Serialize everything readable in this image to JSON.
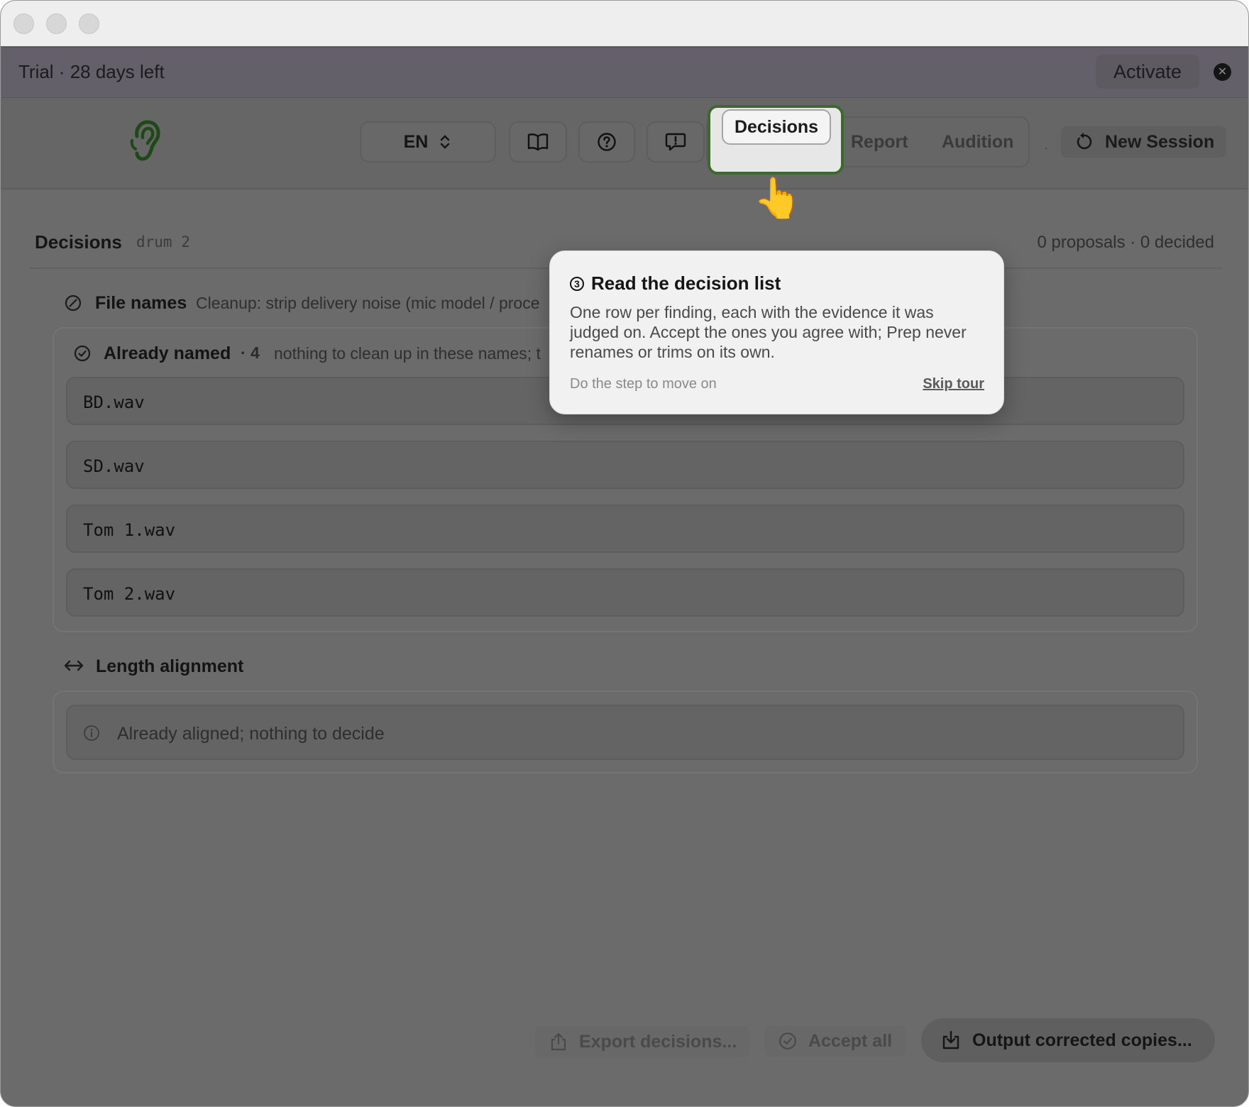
{
  "window": {
    "traffic_lights": [
      "close",
      "minimize",
      "zoom"
    ]
  },
  "trial_banner": {
    "text": "Trial · 28 days left",
    "activate_label": "Activate",
    "dismiss_icon": "close-circle-icon"
  },
  "toolbar": {
    "logo_icon": "ear-logo-icon",
    "language": "EN",
    "guide_icon": "book-icon",
    "help_icon": "question-icon",
    "feedback_icon": "feedback-icon",
    "tabs": [
      {
        "label": "Decisions",
        "active": true
      },
      {
        "label": "Report",
        "active": false
      },
      {
        "label": "Audition",
        "active": false
      }
    ],
    "separator": "·",
    "new_session_label": "New Session",
    "highlight_color": "#3d6a2c"
  },
  "decisions": {
    "title": "Decisions",
    "session_name": "drum 2",
    "counts": "0 proposals · 0 decided"
  },
  "file_names": {
    "title": "File names",
    "description": "Cleanup: strip delivery noise (mic model / proce",
    "already_named": {
      "title": "Already named",
      "count": "· 4",
      "description": "nothing to clean up in these names; t",
      "files": [
        "BD.wav",
        "SD.wav",
        "Tom 1.wav",
        "Tom 2.wav"
      ]
    }
  },
  "length_alignment": {
    "title": "Length alignment",
    "info": "Already aligned; nothing to decide"
  },
  "actions": {
    "export_label": "Export decisions...",
    "accept_all_label": "Accept all",
    "output_label": "Output corrected copies..."
  },
  "tour": {
    "step": "3",
    "title": "Read the decision list",
    "body": "One row per finding, each with the evidence it was judged on. Accept the ones you agree with; Prep never renames or trims on its own.",
    "hint": "Do the step to move on",
    "skip_label": "Skip tour"
  }
}
